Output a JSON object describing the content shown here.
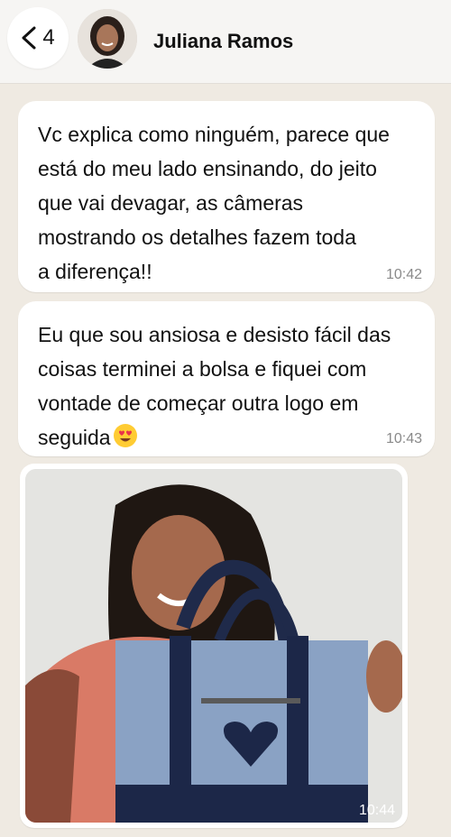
{
  "header": {
    "back_count": "4",
    "contact_name": "Juliana Ramos"
  },
  "messages": [
    {
      "text": "Vc explica como ninguém, parece que\nestá do meu lado ensinando, do jeito\nque vai devagar, as câmeras\nmostrando os detalhes fazem toda\na diferença!!",
      "time": "10:42"
    },
    {
      "text": "Eu que sou ansiosa e desisto fácil das\ncoisas terminei a bolsa e fiquei com\nvontade de começar outra logo em\nseguida",
      "time": "10:43",
      "emoji": "heart-eyes-emoji"
    }
  ],
  "photo_message": {
    "time": "10:44"
  },
  "colors": {
    "background": "#efeae2",
    "bubble": "#ffffff",
    "header": "#f6f5f3"
  }
}
